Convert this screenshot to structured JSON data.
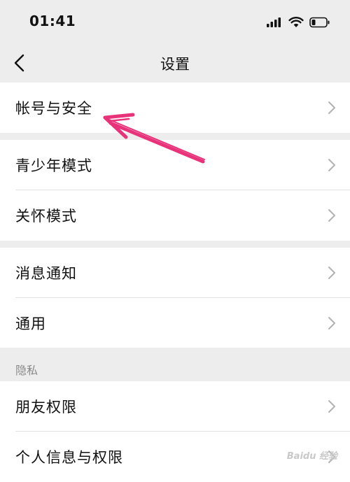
{
  "status_bar": {
    "time": "01:41"
  },
  "nav": {
    "title": "设置"
  },
  "groups": [
    {
      "items": [
        {
          "label": "帐号与安全"
        }
      ]
    },
    {
      "items": [
        {
          "label": "青少年模式"
        },
        {
          "label": "关怀模式"
        }
      ]
    },
    {
      "items": [
        {
          "label": "消息通知"
        },
        {
          "label": "通用"
        }
      ]
    }
  ],
  "privacy_section": {
    "header": "隐私",
    "items": [
      {
        "label": "朋友权限"
      },
      {
        "label": "个人信息与权限"
      }
    ]
  },
  "annotation": {
    "arrow_color": "#e8337a"
  },
  "watermark": {
    "text": "Baidu 经验"
  }
}
